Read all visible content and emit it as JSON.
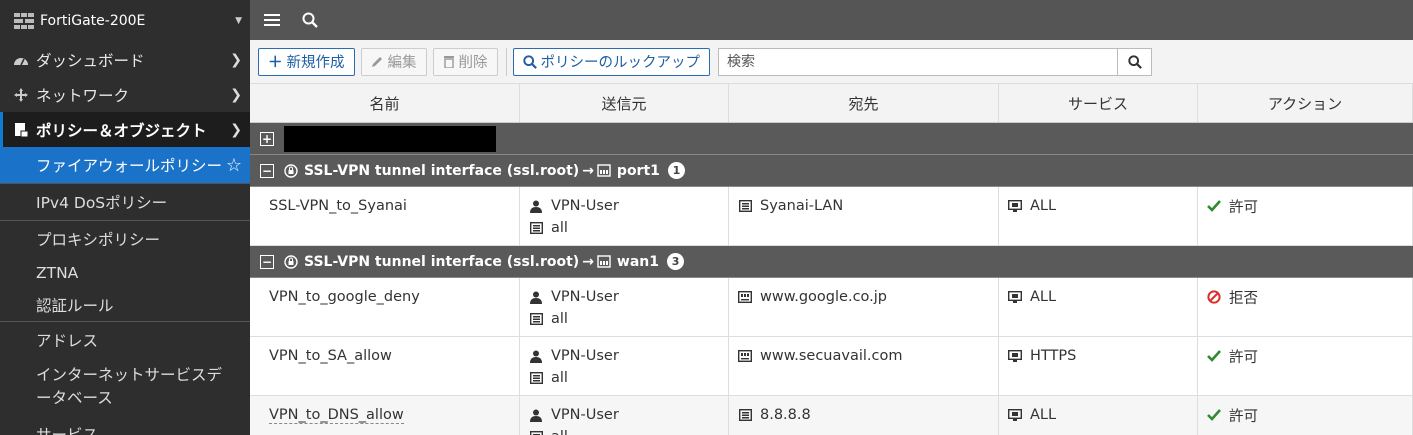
{
  "sidebar": {
    "device": "FortiGate-200E",
    "items": [
      {
        "label": "ダッシュボード"
      },
      {
        "label": "ネットワーク"
      },
      {
        "label": "ポリシー＆オブジェクト"
      }
    ],
    "subitems": [
      {
        "label": "ファイアウォールポリシー"
      },
      {
        "label": "IPv4 DoSポリシー"
      },
      {
        "label": "プロキシポリシー"
      },
      {
        "label": "ZTNA"
      },
      {
        "label": "認証ルール"
      },
      {
        "label": "アドレス"
      },
      {
        "label": "インターネットサービスデータベース"
      },
      {
        "label": "サービス"
      }
    ]
  },
  "toolbar": {
    "create_label": "新規作成",
    "edit_label": "編集",
    "delete_label": "削除",
    "lookup_label": "ポリシーのルックアップ",
    "search_placeholder": "検索"
  },
  "table": {
    "columns": [
      "名前",
      "送信元",
      "宛先",
      "サービス",
      "アクション"
    ],
    "groups": [
      {
        "label": "SSL-VPN tunnel interface (ssl.root)",
        "arrow": "→",
        "dest": "port1",
        "count": "1",
        "rows": [
          {
            "name": "SSL-VPN_to_Syanai",
            "src_user": "VPN-User",
            "src_addr": "all",
            "dst": "Syanai-LAN",
            "service": "ALL",
            "action": "許可"
          }
        ]
      },
      {
        "label": "SSL-VPN tunnel interface (ssl.root)",
        "arrow": "→",
        "dest": "wan1",
        "count": "3",
        "rows": [
          {
            "name": "VPN_to_google_deny",
            "src_user": "VPN-User",
            "src_addr": "all",
            "dst": "www.google.co.jp",
            "service": "ALL",
            "action": "拒否"
          },
          {
            "name": "VPN_to_SA_allow",
            "src_user": "VPN-User",
            "src_addr": "all",
            "dst": "www.secuavail.com",
            "service": "HTTPS",
            "action": "許可"
          },
          {
            "name": "VPN_to_DNS_allow",
            "src_user": "VPN-User",
            "src_addr": "all",
            "dst": "8.8.8.8",
            "service": "ALL",
            "action": "許可"
          }
        ]
      }
    ]
  },
  "colors": {
    "accent": "#1a73c9",
    "allow": "#2e8b2e",
    "deny": "#d9302b"
  }
}
